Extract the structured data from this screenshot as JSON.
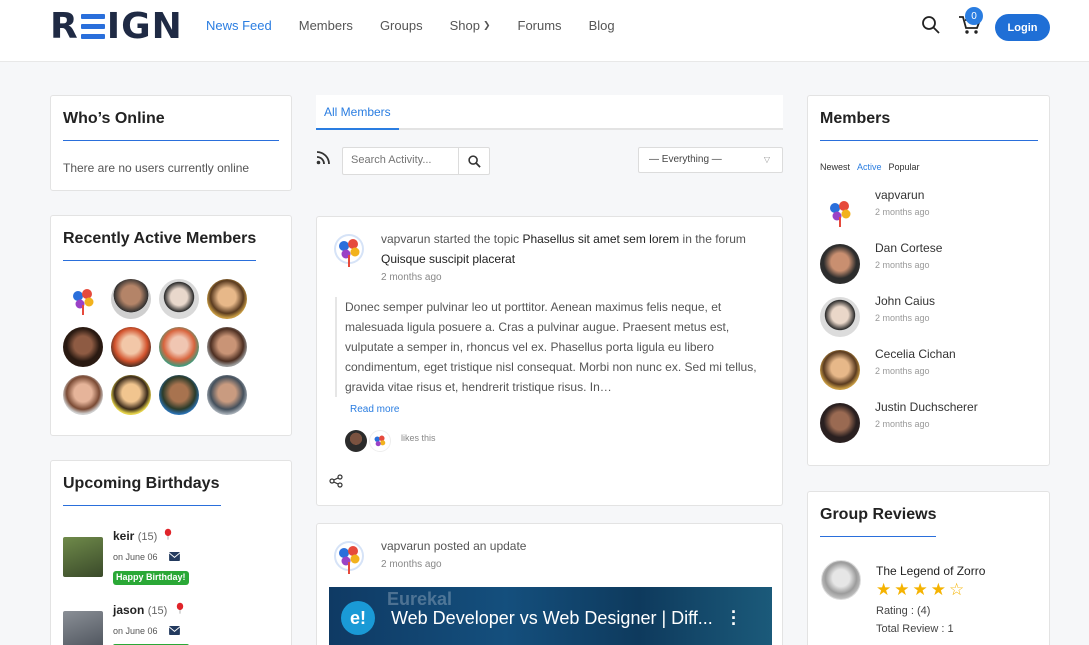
{
  "brand": {
    "name": "REIGN",
    "accent": "#2a6fdb"
  },
  "nav": {
    "items": [
      {
        "label": "News Feed",
        "active": true
      },
      {
        "label": "Members"
      },
      {
        "label": "Groups"
      },
      {
        "label": "Shop",
        "has_dropdown": true
      },
      {
        "label": "Forums"
      },
      {
        "label": "Blog"
      }
    ]
  },
  "header": {
    "cart_count": "0",
    "login_label": "Login"
  },
  "whos_online": {
    "title": "Who’s Online",
    "text": "There are no users currently online"
  },
  "recently_active": {
    "title": "Recently Active Members"
  },
  "birthdays": {
    "title": "Upcoming Birthdays",
    "items": [
      {
        "name": "keir",
        "age": "(15)",
        "date": "on June 06",
        "badge": "Happy Birthday!"
      },
      {
        "name": "jason",
        "age": "(15)",
        "date": "on June 06"
      }
    ]
  },
  "activity": {
    "tab": "All Members",
    "search_placeholder": "Search Activity...",
    "filter_value": "— Everything —",
    "posts": [
      {
        "user": "vapvarun",
        "action": "started the topic",
        "topic": "Phasellus sit amet sem lorem",
        "in_the_forum": "in the forum",
        "forum": "Quisque suscipit placerat",
        "time": "2 months ago",
        "excerpt": "Donec semper pulvinar leo ut porttitor. Aenean maximus felis neque, et malesuada ligula posuere a. Cras a pulvinar augue. Praesent metus est, vulputate a semper in, rhoncus vel ex. Phasellus porta ligula eu libero condimentum, eget tristique nisl consequat. Morbi non nunc ex. Sed mi tellus, gravida vitae risus et, hendrerit tristique risus. In…",
        "read_more": "Read more",
        "likes": "likes this"
      },
      {
        "user": "vapvarun",
        "action": "posted an update",
        "time": "2 months ago",
        "video_title": "Web Developer vs Web Designer | Diff...",
        "video_channel": "Eurekal",
        "video_logo": "e!"
      }
    ]
  },
  "members_widget": {
    "title": "Members",
    "tabs": [
      "Newest",
      "Active",
      "Popular"
    ],
    "active_tab": "Active",
    "members": [
      {
        "name": "vapvarun",
        "time": "2 months ago"
      },
      {
        "name": "Dan Cortese",
        "time": "2 months ago"
      },
      {
        "name": "John Caius",
        "time": "2 months ago"
      },
      {
        "name": "Cecelia Cichan",
        "time": "2 months ago"
      },
      {
        "name": "Justin Duchscherer",
        "time": "2 months ago"
      }
    ]
  },
  "group_reviews": {
    "title": "Group Reviews",
    "group": "The Legend of Zorro",
    "rating_label": "Rating : (4)",
    "rating": 4,
    "rating_max": 5,
    "total_label": "Total Review : 1"
  }
}
